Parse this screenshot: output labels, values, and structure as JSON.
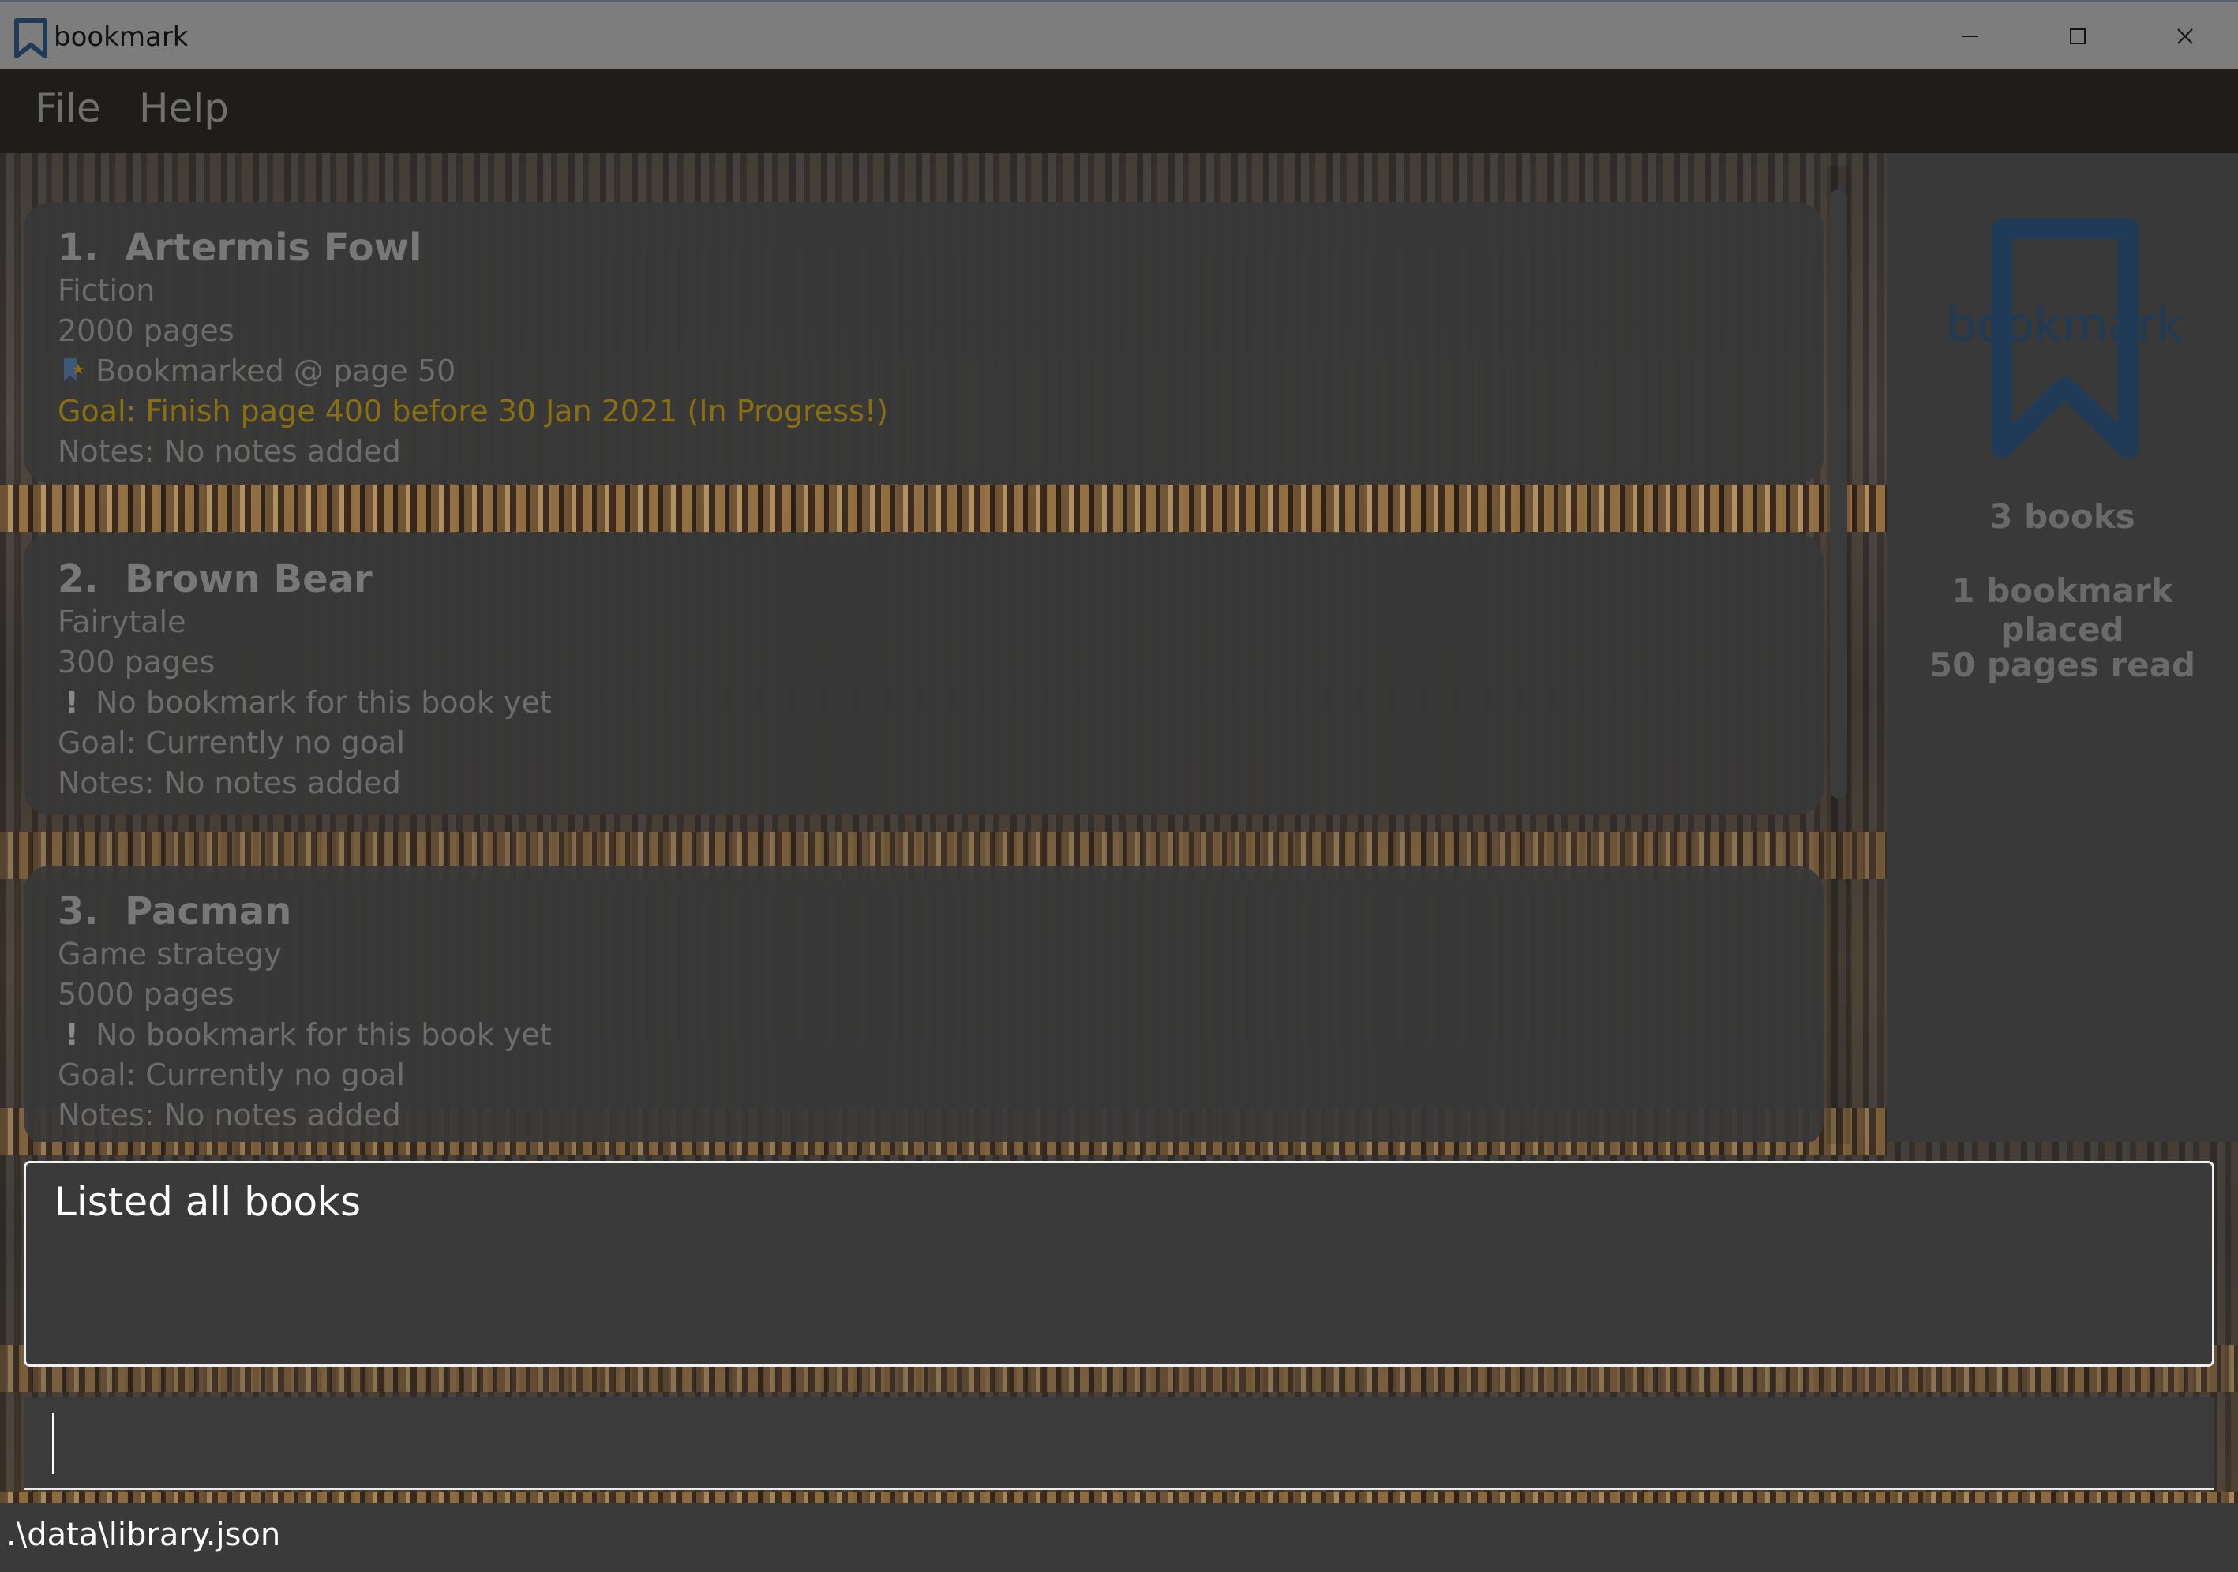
{
  "window": {
    "title": "bookmark",
    "icon": "bookmark-icon",
    "controls": [
      "minimize-icon",
      "maximize-icon",
      "close-icon"
    ]
  },
  "menu": {
    "file": "File",
    "help": "Help"
  },
  "books": [
    {
      "index": "1.",
      "name": "Artermis Fowl",
      "genre": "Fiction",
      "pages": "2000 pages",
      "bookmark": "Bookmarked @ page 50",
      "bookmark_icon": "bookmark-star-icon",
      "goal": "Goal: Finish page 400 before 30 Jan 2021 (In Progress!)",
      "notes": "Notes: No notes added"
    },
    {
      "index": "2.",
      "name": "Brown Bear",
      "genre": "Fairytale",
      "pages": "300 pages",
      "bookmark": "No bookmark for this book yet",
      "bookmark_icon": "exclamation-icon",
      "goal": "Goal: Currently no goal",
      "notes": "Notes: No notes added"
    },
    {
      "index": "3.",
      "name": "Pacman",
      "genre": "Game strategy",
      "pages": "5000 pages",
      "bookmark": "No bookmark for this book yet",
      "bookmark_icon": "exclamation-icon",
      "goal": "Goal: Currently no goal",
      "notes": "Notes: No notes added"
    }
  ],
  "side_panel": {
    "logo_text": "bookmark",
    "books_count": "3 books",
    "bookmarks_placed": "1 bookmark placed",
    "pages_read": "50 pages read"
  },
  "result_display": {
    "text": "Listed all books"
  },
  "command_box": {
    "value": ""
  },
  "status_bar": {
    "path": ".\\data\\library.json"
  },
  "colors": {
    "goal_in_progress": "#8a6f10",
    "logo_accent": "#1f3b57",
    "result_border": "#f0f0f0"
  }
}
